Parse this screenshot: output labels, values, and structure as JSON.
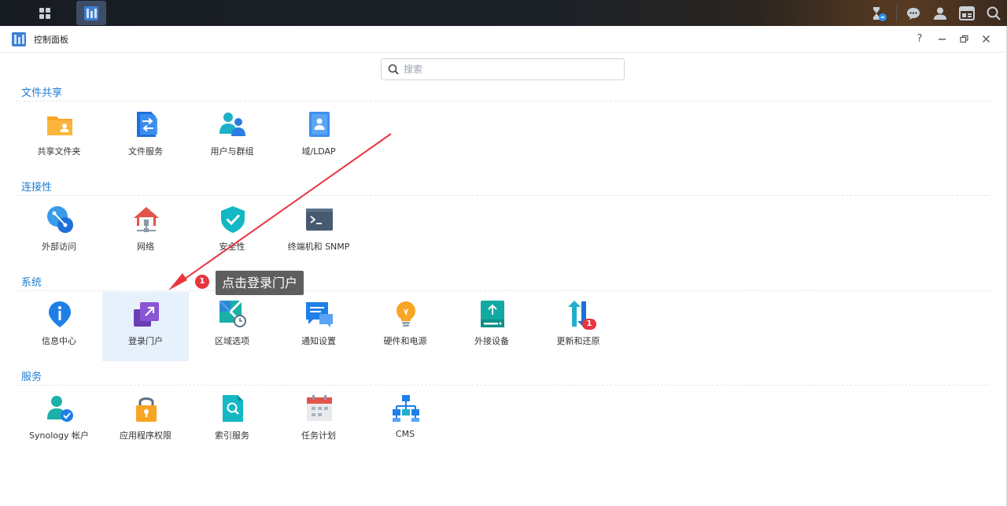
{
  "window": {
    "title": "控制面板"
  },
  "search": {
    "placeholder": "搜索",
    "value": ""
  },
  "titlebar_controls": [
    "help-icon",
    "minimize-icon",
    "restore-icon",
    "close-icon"
  ],
  "colors": {
    "accent": "#1f7bd1",
    "selected_tile": "#e6f1fc",
    "badge": "#e8363e",
    "tooltip_bg": "#5e5e5e"
  },
  "sections": [
    {
      "title": "文件共享",
      "items": [
        {
          "label": "共享文件夹",
          "icon": "shared-folder-icon"
        },
        {
          "label": "文件服务",
          "icon": "file-services-icon"
        },
        {
          "label": "用户与群组",
          "icon": "users-groups-icon"
        },
        {
          "label": "域/LDAP",
          "icon": "domain-ldap-icon"
        }
      ]
    },
    {
      "title": "连接性",
      "items": [
        {
          "label": "外部访问",
          "icon": "external-access-icon"
        },
        {
          "label": "网络",
          "icon": "network-icon"
        },
        {
          "label": "安全性",
          "icon": "security-shield-icon"
        },
        {
          "label": "终端机和 SNMP",
          "icon": "terminal-icon"
        }
      ]
    },
    {
      "title": "系统",
      "items": [
        {
          "label": "信息中心",
          "icon": "info-center-icon"
        },
        {
          "label": "登录门户",
          "icon": "login-portal-icon",
          "selected": true
        },
        {
          "label": "区域选项",
          "icon": "regional-options-icon"
        },
        {
          "label": "通知设置",
          "icon": "notification-icon"
        },
        {
          "label": "硬件和电源",
          "icon": "hardware-power-icon"
        },
        {
          "label": "外接设备",
          "icon": "external-devices-icon"
        },
        {
          "label": "更新和还原",
          "icon": "update-restore-icon",
          "badge": "1"
        }
      ]
    },
    {
      "title": "服务",
      "items": [
        {
          "label": "Synology 帐户",
          "icon": "synology-account-icon"
        },
        {
          "label": "应用程序权限",
          "icon": "app-privileges-icon"
        },
        {
          "label": "索引服务",
          "icon": "indexing-service-icon"
        },
        {
          "label": "任务计划",
          "icon": "task-scheduler-icon"
        },
        {
          "label": "CMS",
          "icon": "cms-icon"
        }
      ]
    }
  ],
  "annotation": {
    "number": "1",
    "text": "点击登录门户"
  }
}
